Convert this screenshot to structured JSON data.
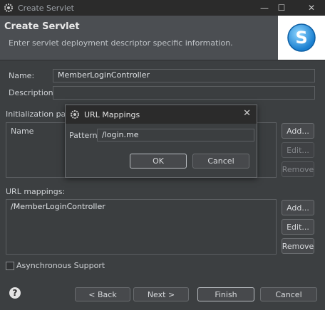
{
  "window": {
    "title": "Create Servlet",
    "minimize_glyph": "—",
    "maximize_glyph": "☐",
    "close_glyph": "✕"
  },
  "header": {
    "title": "Create Servlet",
    "description": "Enter servlet deployment descriptor specific information.",
    "logo_letter": "S"
  },
  "form": {
    "name_label": "Name:",
    "name_value": "MemberLoginController",
    "description_label": "Description:",
    "description_value": "",
    "init_params_label": "Initialization para",
    "init_table_header": "Name",
    "init_buttons": {
      "add": "Add...",
      "edit": "Edit...",
      "remove": "Remove"
    },
    "url_mappings_label": "URL mappings:",
    "url_mappings": [
      "/MemberLoginController"
    ],
    "url_buttons": {
      "add": "Add...",
      "edit": "Edit...",
      "remove": "Remove"
    },
    "async_label": "Asynchronous Support",
    "async_checked": false
  },
  "footer": {
    "help_glyph": "?",
    "back": "< Back",
    "next": "Next >",
    "finish": "Finish",
    "cancel": "Cancel"
  },
  "dialog": {
    "title": "URL Mappings",
    "close_glyph": "✕",
    "pattern_label": "Pattern:",
    "pattern_value": "/login.me",
    "ok": "OK",
    "cancel": "Cancel"
  }
}
